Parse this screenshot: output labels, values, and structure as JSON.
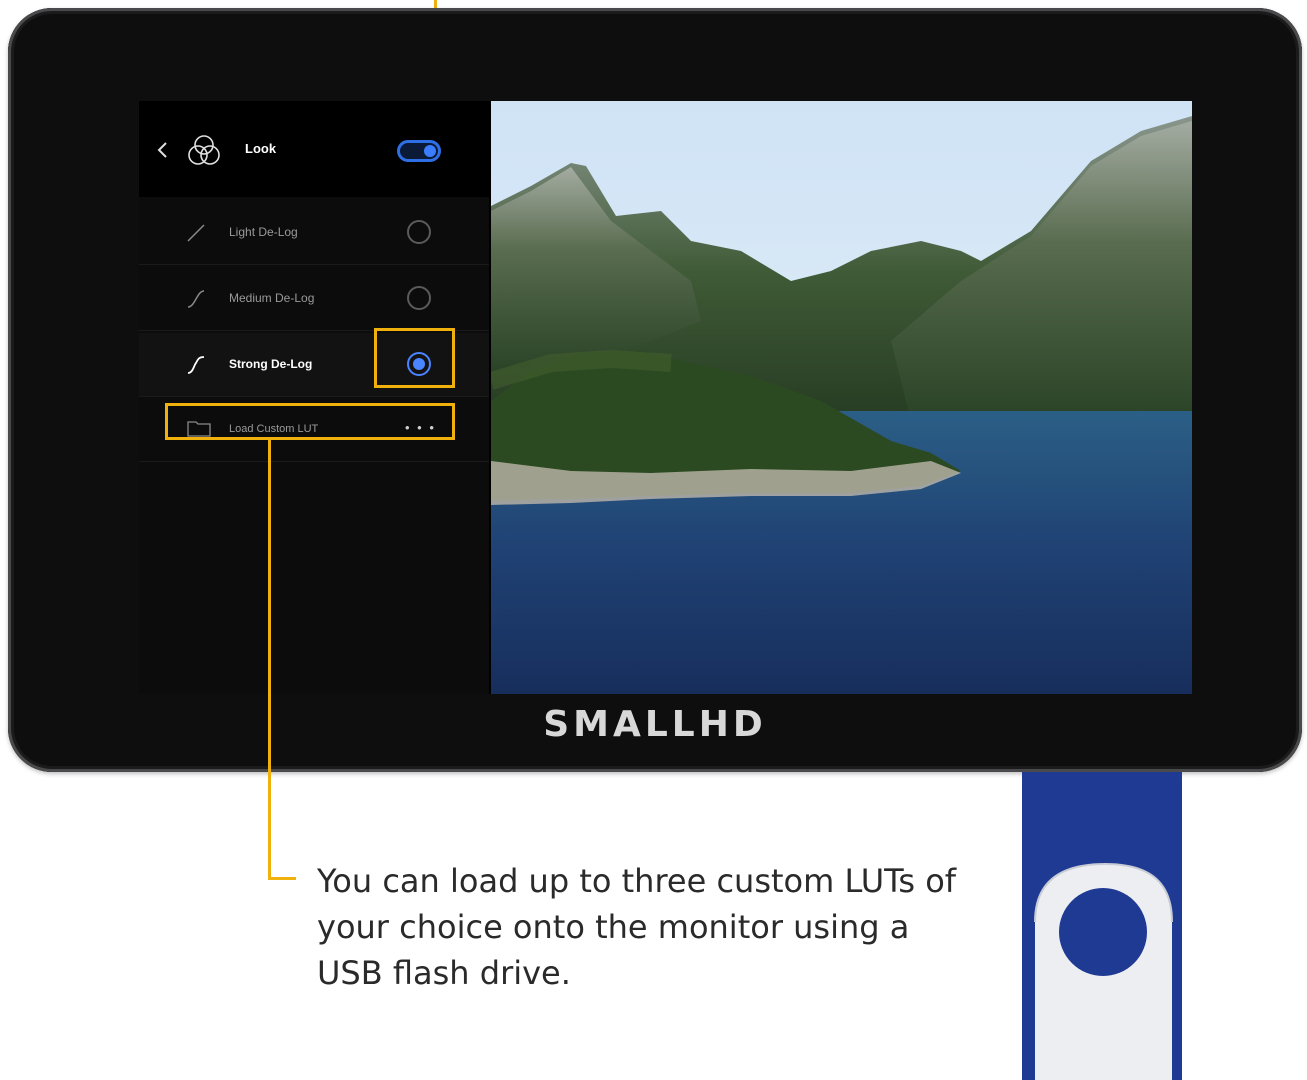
{
  "menu": {
    "title": "Look",
    "toggle_on": true,
    "items": [
      {
        "label": "Light De-Log",
        "selected": false
      },
      {
        "label": "Medium De-Log",
        "selected": false
      },
      {
        "label": "Strong De-Log",
        "selected": true
      }
    ],
    "load_custom_label": "Load Custom LUT",
    "more_label": "• • •"
  },
  "device": {
    "brand": "SMALLHD"
  },
  "annotation": {
    "caption": "You can load up to three custom LUTs of your choice onto the monitor using a USB flash drive."
  },
  "colors": {
    "accent_blue": "#3a7dff",
    "callout_yellow": "#f1b10d",
    "usb_blue": "#1f3a93"
  }
}
